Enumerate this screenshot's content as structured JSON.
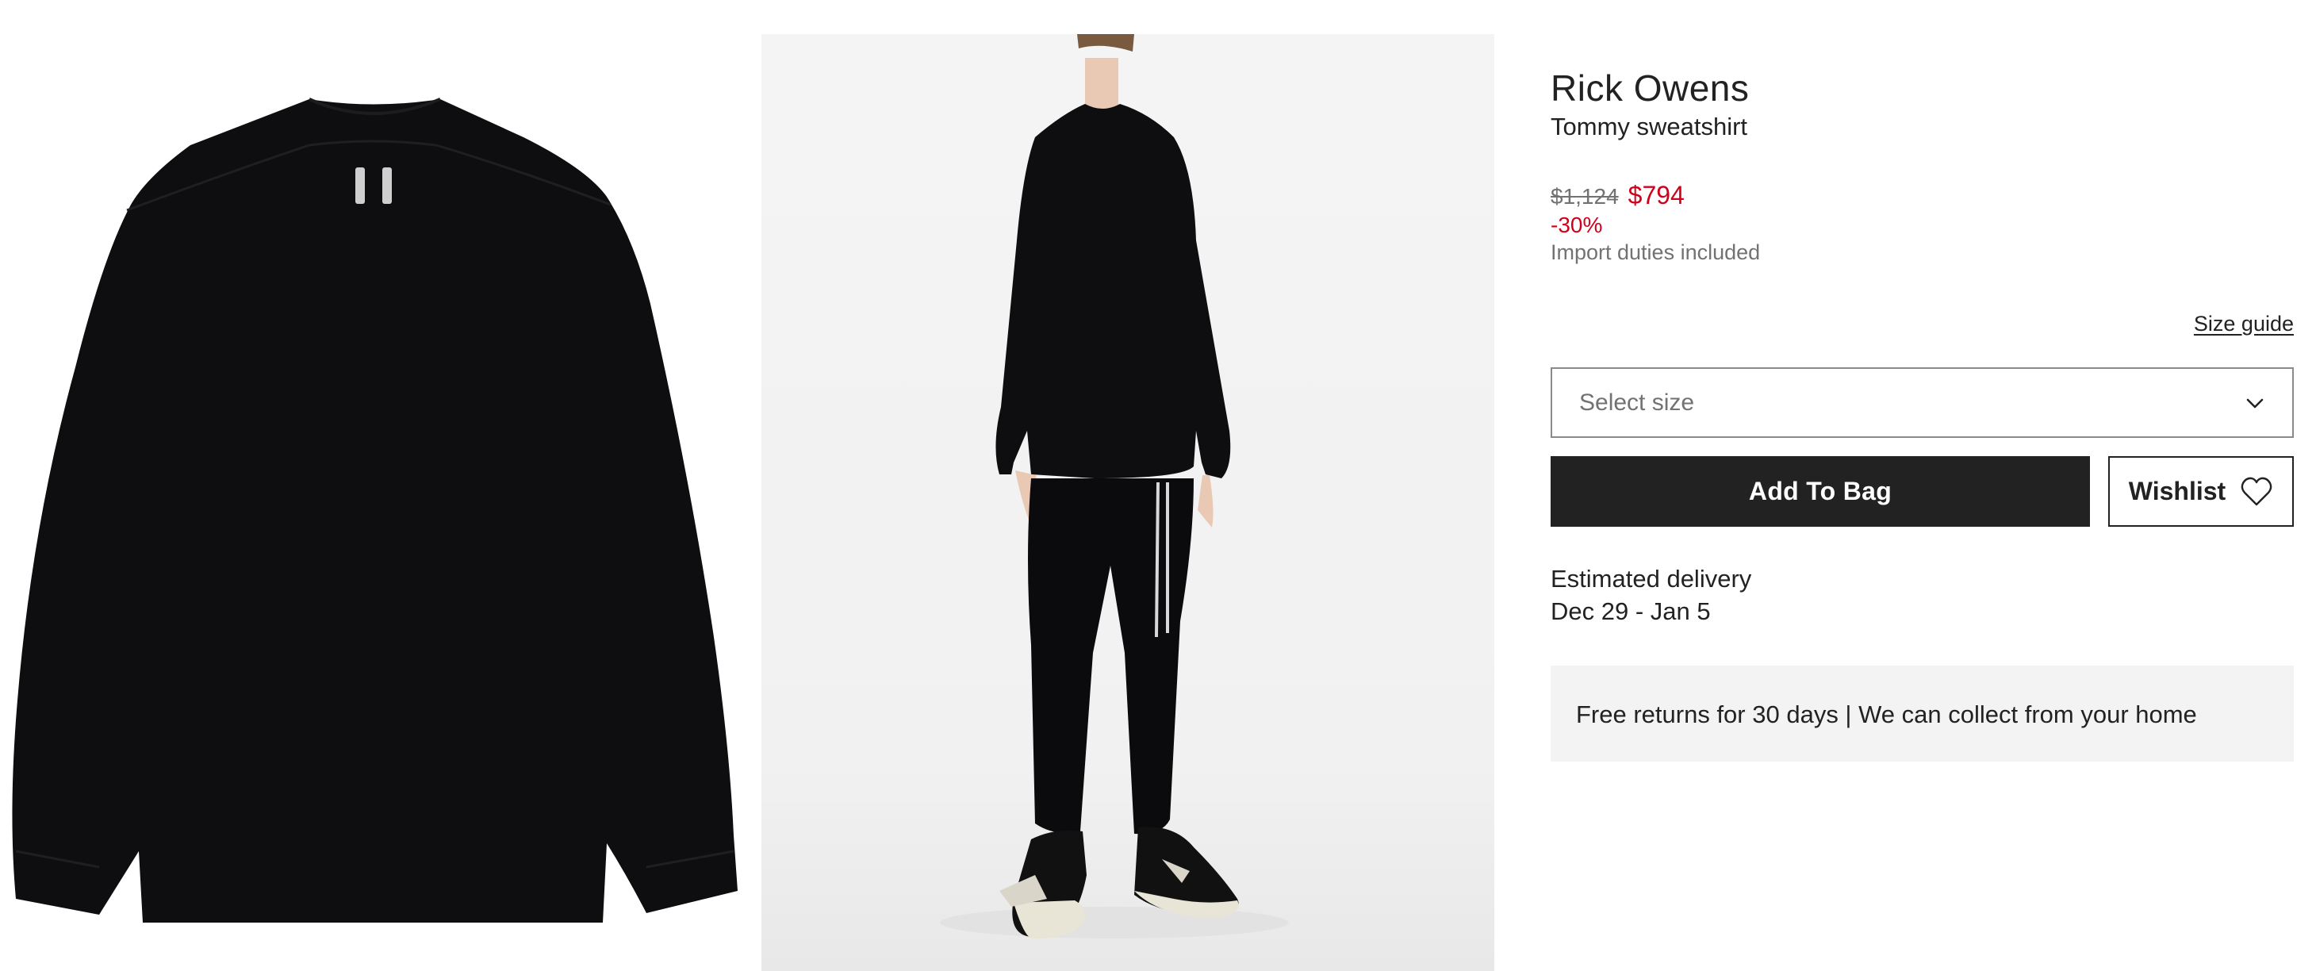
{
  "product": {
    "brand": "Rick Owens",
    "name": "Tommy sweatshirt",
    "price_original": "$1,124",
    "price_sale": "$794",
    "discount": "-30%",
    "duties_note": "Import duties included",
    "sale_color": "#d0021b"
  },
  "gallery": {
    "images": [
      {
        "name": "front-view",
        "icon": "sweatshirt-image"
      },
      {
        "name": "model-view",
        "icon": "model-image"
      }
    ]
  },
  "size": {
    "guide_label": "Size guide",
    "placeholder": "Select size",
    "icon": "chevron-down-icon"
  },
  "actions": {
    "add_to_bag": "Add To Bag",
    "wishlist": "Wishlist",
    "wishlist_icon": "heart-icon"
  },
  "delivery": {
    "label": "Estimated delivery",
    "dates": "Dec 29 - Jan 5"
  },
  "returns": {
    "text": "Free returns for 30 days | We can collect from your home"
  }
}
